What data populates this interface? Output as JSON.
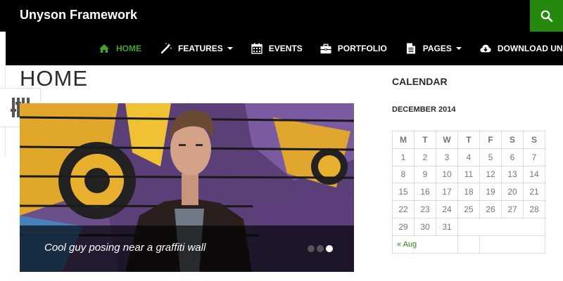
{
  "site": {
    "title": "Unyson Framework"
  },
  "nav": {
    "items": [
      {
        "label": "HOME",
        "icon": "home-icon",
        "active": true
      },
      {
        "label": "FEATURES",
        "icon": "magic-wand-icon",
        "dropdown": true
      },
      {
        "label": "EVENTS",
        "icon": "calendar-icon"
      },
      {
        "label": "PORTFOLIO",
        "icon": "briefcase-icon"
      },
      {
        "label": "PAGES",
        "icon": "document-icon",
        "dropdown": true
      },
      {
        "label": "DOWNLOAD UNYSON",
        "icon": "cloud-download-icon"
      }
    ]
  },
  "colors": {
    "accent": "#24890d",
    "active_nav": "#41a62a",
    "bar": "#000000"
  },
  "page": {
    "title": "HOME"
  },
  "slider": {
    "caption": "Cool guy posing near a graffiti wall",
    "slide_count": 3,
    "active_index": 2
  },
  "sidebar": {
    "widget_title": "CALENDAR",
    "calendar": {
      "caption": "DECEMBER 2014",
      "weekdays": [
        "M",
        "T",
        "W",
        "T",
        "F",
        "S",
        "S"
      ],
      "rows": [
        [
          "1",
          "2",
          "3",
          "4",
          "5",
          "6",
          "7"
        ],
        [
          "8",
          "9",
          "10",
          "11",
          "12",
          "13",
          "14"
        ],
        [
          "15",
          "16",
          "17",
          "18",
          "19",
          "20",
          "21"
        ],
        [
          "22",
          "23",
          "24",
          "25",
          "26",
          "27",
          "28"
        ],
        [
          "29",
          "30",
          "31",
          "",
          "",
          "",
          ""
        ]
      ],
      "prev_link": "« Aug"
    }
  }
}
